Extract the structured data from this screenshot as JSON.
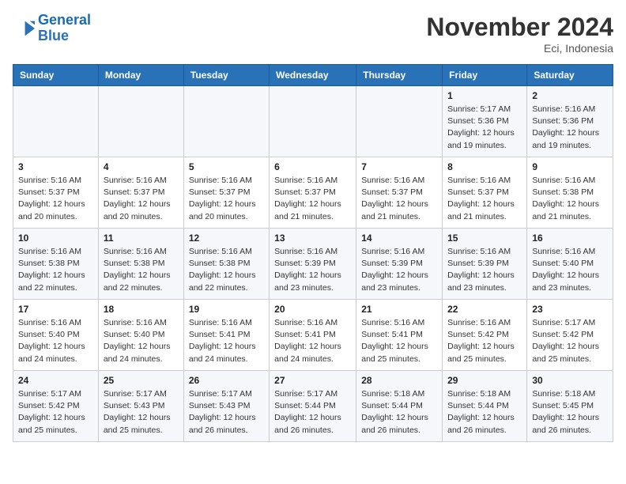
{
  "header": {
    "logo_line1": "General",
    "logo_line2": "Blue",
    "month_title": "November 2024",
    "location": "Eci, Indonesia"
  },
  "weekdays": [
    "Sunday",
    "Monday",
    "Tuesday",
    "Wednesday",
    "Thursday",
    "Friday",
    "Saturday"
  ],
  "weeks": [
    [
      {
        "day": "",
        "info": ""
      },
      {
        "day": "",
        "info": ""
      },
      {
        "day": "",
        "info": ""
      },
      {
        "day": "",
        "info": ""
      },
      {
        "day": "",
        "info": ""
      },
      {
        "day": "1",
        "info": "Sunrise: 5:17 AM\nSunset: 5:36 PM\nDaylight: 12 hours and 19 minutes."
      },
      {
        "day": "2",
        "info": "Sunrise: 5:16 AM\nSunset: 5:36 PM\nDaylight: 12 hours and 19 minutes."
      }
    ],
    [
      {
        "day": "3",
        "info": "Sunrise: 5:16 AM\nSunset: 5:37 PM\nDaylight: 12 hours and 20 minutes."
      },
      {
        "day": "4",
        "info": "Sunrise: 5:16 AM\nSunset: 5:37 PM\nDaylight: 12 hours and 20 minutes."
      },
      {
        "day": "5",
        "info": "Sunrise: 5:16 AM\nSunset: 5:37 PM\nDaylight: 12 hours and 20 minutes."
      },
      {
        "day": "6",
        "info": "Sunrise: 5:16 AM\nSunset: 5:37 PM\nDaylight: 12 hours and 21 minutes."
      },
      {
        "day": "7",
        "info": "Sunrise: 5:16 AM\nSunset: 5:37 PM\nDaylight: 12 hours and 21 minutes."
      },
      {
        "day": "8",
        "info": "Sunrise: 5:16 AM\nSunset: 5:37 PM\nDaylight: 12 hours and 21 minutes."
      },
      {
        "day": "9",
        "info": "Sunrise: 5:16 AM\nSunset: 5:38 PM\nDaylight: 12 hours and 21 minutes."
      }
    ],
    [
      {
        "day": "10",
        "info": "Sunrise: 5:16 AM\nSunset: 5:38 PM\nDaylight: 12 hours and 22 minutes."
      },
      {
        "day": "11",
        "info": "Sunrise: 5:16 AM\nSunset: 5:38 PM\nDaylight: 12 hours and 22 minutes."
      },
      {
        "day": "12",
        "info": "Sunrise: 5:16 AM\nSunset: 5:38 PM\nDaylight: 12 hours and 22 minutes."
      },
      {
        "day": "13",
        "info": "Sunrise: 5:16 AM\nSunset: 5:39 PM\nDaylight: 12 hours and 23 minutes."
      },
      {
        "day": "14",
        "info": "Sunrise: 5:16 AM\nSunset: 5:39 PM\nDaylight: 12 hours and 23 minutes."
      },
      {
        "day": "15",
        "info": "Sunrise: 5:16 AM\nSunset: 5:39 PM\nDaylight: 12 hours and 23 minutes."
      },
      {
        "day": "16",
        "info": "Sunrise: 5:16 AM\nSunset: 5:40 PM\nDaylight: 12 hours and 23 minutes."
      }
    ],
    [
      {
        "day": "17",
        "info": "Sunrise: 5:16 AM\nSunset: 5:40 PM\nDaylight: 12 hours and 24 minutes."
      },
      {
        "day": "18",
        "info": "Sunrise: 5:16 AM\nSunset: 5:40 PM\nDaylight: 12 hours and 24 minutes."
      },
      {
        "day": "19",
        "info": "Sunrise: 5:16 AM\nSunset: 5:41 PM\nDaylight: 12 hours and 24 minutes."
      },
      {
        "day": "20",
        "info": "Sunrise: 5:16 AM\nSunset: 5:41 PM\nDaylight: 12 hours and 24 minutes."
      },
      {
        "day": "21",
        "info": "Sunrise: 5:16 AM\nSunset: 5:41 PM\nDaylight: 12 hours and 25 minutes."
      },
      {
        "day": "22",
        "info": "Sunrise: 5:16 AM\nSunset: 5:42 PM\nDaylight: 12 hours and 25 minutes."
      },
      {
        "day": "23",
        "info": "Sunrise: 5:17 AM\nSunset: 5:42 PM\nDaylight: 12 hours and 25 minutes."
      }
    ],
    [
      {
        "day": "24",
        "info": "Sunrise: 5:17 AM\nSunset: 5:42 PM\nDaylight: 12 hours and 25 minutes."
      },
      {
        "day": "25",
        "info": "Sunrise: 5:17 AM\nSunset: 5:43 PM\nDaylight: 12 hours and 25 minutes."
      },
      {
        "day": "26",
        "info": "Sunrise: 5:17 AM\nSunset: 5:43 PM\nDaylight: 12 hours and 26 minutes."
      },
      {
        "day": "27",
        "info": "Sunrise: 5:17 AM\nSunset: 5:44 PM\nDaylight: 12 hours and 26 minutes."
      },
      {
        "day": "28",
        "info": "Sunrise: 5:18 AM\nSunset: 5:44 PM\nDaylight: 12 hours and 26 minutes."
      },
      {
        "day": "29",
        "info": "Sunrise: 5:18 AM\nSunset: 5:44 PM\nDaylight: 12 hours and 26 minutes."
      },
      {
        "day": "30",
        "info": "Sunrise: 5:18 AM\nSunset: 5:45 PM\nDaylight: 12 hours and 26 minutes."
      }
    ]
  ]
}
